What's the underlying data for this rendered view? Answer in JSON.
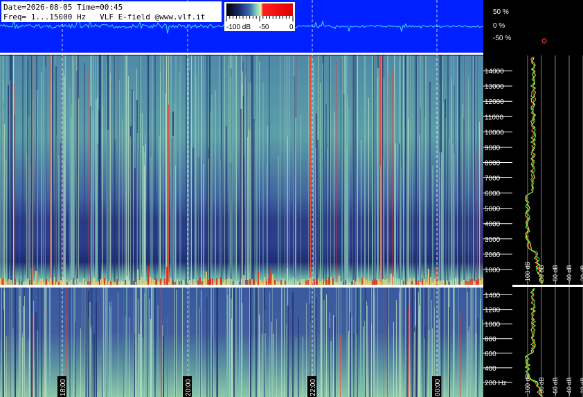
{
  "header": {
    "line1": "Date=2026-08-05 Time=00:45",
    "line2": "Freq= 1...15000 Hz   VLF E-field @www.vlf.it"
  },
  "colorbar": {
    "labels": [
      "-100 dB",
      "-50",
      "0"
    ],
    "colors": [
      "#000000",
      "#1a2a6e",
      "#3a6fb0",
      "#7fd0c0",
      "#e8f0a0",
      "#ff2020",
      "#e00000"
    ]
  },
  "waveform": {
    "labels": [
      "50 %",
      "0 %",
      "-50 %"
    ],
    "background": "#0020ff",
    "trace_color": "#40e0ff"
  },
  "upper_spectrogram": {
    "freq_ticks": [
      "1000",
      "2000",
      "3000",
      "4000",
      "5000",
      "6000",
      "7000",
      "8000",
      "9000",
      "10000",
      "11000",
      "12000",
      "13000",
      "14000"
    ]
  },
  "lower_spectrogram": {
    "freq_ticks": [
      "200 Hz",
      "400",
      "600",
      "800",
      "1000",
      "1200",
      "1400"
    ]
  },
  "time_labels": [
    "18:00",
    "20:00",
    "22:00",
    "00:00"
  ],
  "profile_labels": [
    "-100 dB",
    "-80 dB",
    "-60 dB",
    "-40 dB",
    "-20 dB"
  ],
  "chart_data": [
    {
      "type": "heatmap",
      "title": "",
      "x_ticks": [
        "18:00",
        "20:00",
        "22:00",
        "00:00"
      ],
      "y_ticks": [
        1000,
        2000,
        3000,
        4000,
        5000,
        6000,
        7000,
        8000,
        9000,
        10000,
        11000,
        12000,
        13000,
        14000
      ],
      "ylim": [
        0,
        15000
      ],
      "ylabel": "",
      "color_scale_db": [
        -100,
        0
      ]
    },
    {
      "type": "heatmap",
      "title": "",
      "x_ticks": [
        "18:00",
        "20:00",
        "22:00",
        "00:00"
      ],
      "y_ticks": [
        200,
        400,
        600,
        800,
        1000,
        1200,
        1400
      ],
      "ylim": [
        0,
        1500
      ],
      "ylabel": "Hz",
      "color_scale_db": [
        -100,
        0
      ]
    },
    {
      "type": "line",
      "title": "",
      "x_ticks": [
        "-100 dB",
        "-80 dB",
        "-60 dB",
        "-40 dB",
        "-20 dB"
      ],
      "xlim": [
        -100,
        -20
      ],
      "series": []
    }
  ]
}
